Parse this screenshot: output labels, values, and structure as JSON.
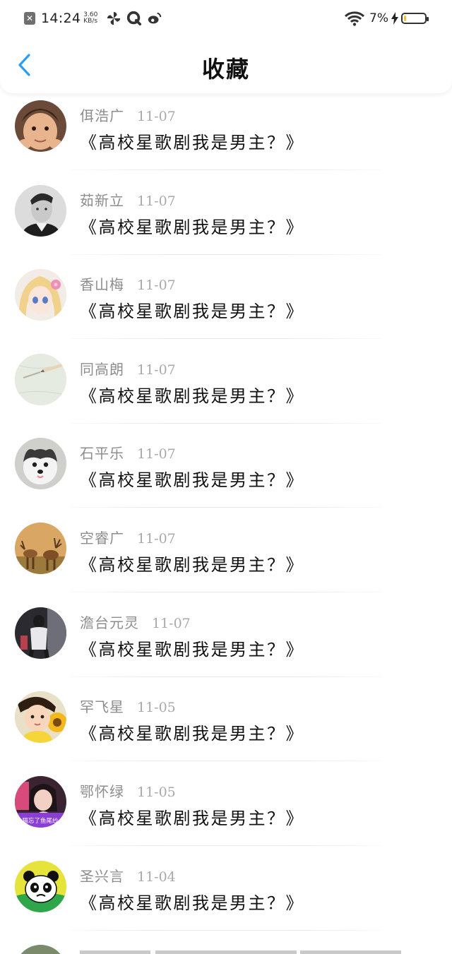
{
  "status_bar": {
    "time": "14:24",
    "net_speed_value": "3.60",
    "net_speed_unit": "KB/s",
    "app_icons": [
      "close-notification-icon",
      "pinwheel-icon",
      "q-app-icon",
      "weibo-icon"
    ],
    "battery_percent": "7%",
    "battery_level": 0.07,
    "charging": true
  },
  "header": {
    "back_icon": "chevron-left-icon",
    "title": "收藏",
    "accent_color": "#2a9df4"
  },
  "favorites": [
    {
      "name": "佴浩广",
      "date": "11-07",
      "title": "《高校星歌剧我是男主？》",
      "avatar": "child-face-avatar"
    },
    {
      "name": "茹新立",
      "date": "11-07",
      "title": "《高校星歌剧我是男主？》",
      "avatar": "man-bw-portrait-avatar"
    },
    {
      "name": "香山梅",
      "date": "11-07",
      "title": "《高校星歌剧我是男主？》",
      "avatar": "anime-girl-avatar"
    },
    {
      "name": "同高朗",
      "date": "11-07",
      "title": "《高校星歌剧我是男主？》",
      "avatar": "paper-pencil-avatar"
    },
    {
      "name": "石平乐",
      "date": "11-07",
      "title": "《高校星歌剧我是男主？》",
      "avatar": "husky-puppy-avatar"
    },
    {
      "name": "空睿广",
      "date": "11-07",
      "title": "《高校星歌剧我是男主？》",
      "avatar": "deer-avatar"
    },
    {
      "name": "澹台元灵",
      "date": "11-07",
      "title": "《高校星歌剧我是男主？》",
      "avatar": "street-person-avatar"
    },
    {
      "name": "罕飞星",
      "date": "11-05",
      "title": "《高校星歌剧我是男主？》",
      "avatar": "toddler-sunflower-avatar"
    },
    {
      "name": "鄂怀绿",
      "date": "11-05",
      "title": "《高校星歌剧我是男主？》",
      "avatar": "girl-purple-caption-avatar",
      "avatar_caption": "猫忘了鱼尾纱"
    },
    {
      "name": "圣兴言",
      "date": "11-04",
      "title": "《高校星歌剧我是男主？》",
      "avatar": "panda-cartoon-avatar"
    }
  ]
}
